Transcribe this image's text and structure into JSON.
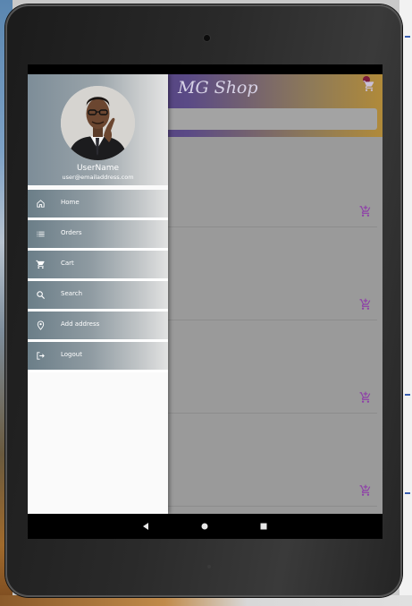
{
  "app": {
    "title": "MG Shop"
  },
  "drawer": {
    "user_name": "UserName",
    "user_email": "user@emailaddress.com",
    "items": [
      {
        "label": "Home",
        "icon": "home-icon"
      },
      {
        "label": "Orders",
        "icon": "list-icon"
      },
      {
        "label": "Cart",
        "icon": "cart-icon"
      },
      {
        "label": "Search",
        "icon": "search-icon"
      },
      {
        "label": "Add address",
        "icon": "location-pin-icon"
      },
      {
        "label": "Logout",
        "icon": "logout-icon"
      }
    ]
  },
  "colors": {
    "appbar_start": "#3e2a6a",
    "appbar_end": "#b08a3a",
    "drawer_item": "#6b7e88",
    "add_cart_accent": "#8e3fa8"
  }
}
